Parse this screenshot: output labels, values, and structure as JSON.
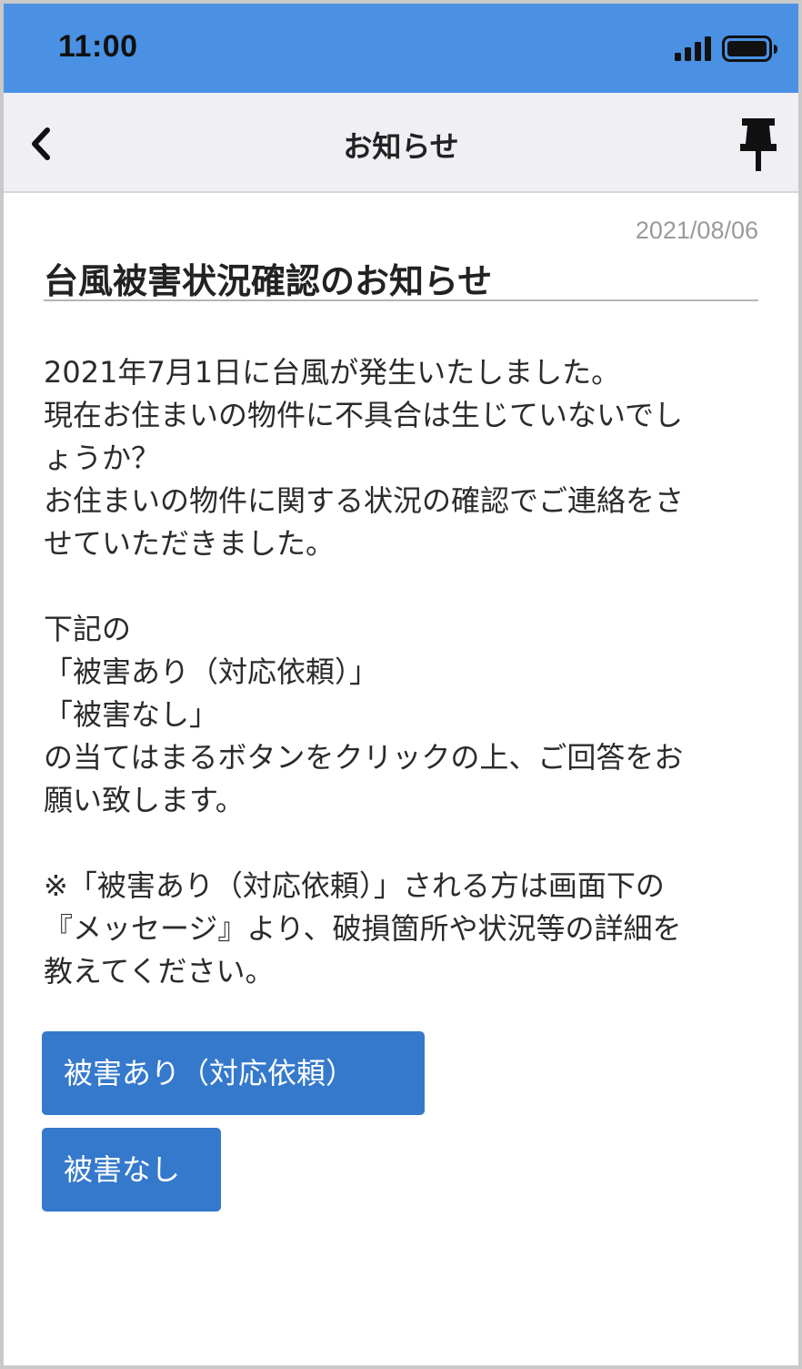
{
  "status_bar": {
    "time": "11:00",
    "signal_icon": "cellular-signal-icon",
    "battery_icon": "battery-full-icon"
  },
  "nav_bar": {
    "back_icon": "chevron-left-icon",
    "title": "お知らせ",
    "pin_icon": "pushpin-icon"
  },
  "notice": {
    "date": "2021/08/06",
    "title": "台風被害状況確認のお知らせ",
    "body_lines": [
      "2021年7月1日に台風が発生いたしました。",
      "現在お住まいの物件に不具合は生じていないでし",
      "ょうか？",
      "お住まいの物件に関する状況の確認でご連絡をさ",
      "せていただきました。",
      "",
      "下記の",
      "「被害あり（対応依頼）」",
      "「被害なし」",
      "の当てはまるボタンをクリックの上、ご回答をお",
      "願い致します。",
      "",
      "※「被害あり（対応依頼）」される方は画面下の",
      "『メッセージ』より、破損箇所や状況等の詳細を",
      "教えてください。"
    ]
  },
  "buttons": {
    "damage_yes": "被害あり（対応依頼）",
    "damage_no": "被害なし"
  },
  "colors": {
    "status_bar": "#4a91e4",
    "nav_bar": "#efeff4",
    "button": "#3579cc",
    "button_text": "#ffffff"
  }
}
